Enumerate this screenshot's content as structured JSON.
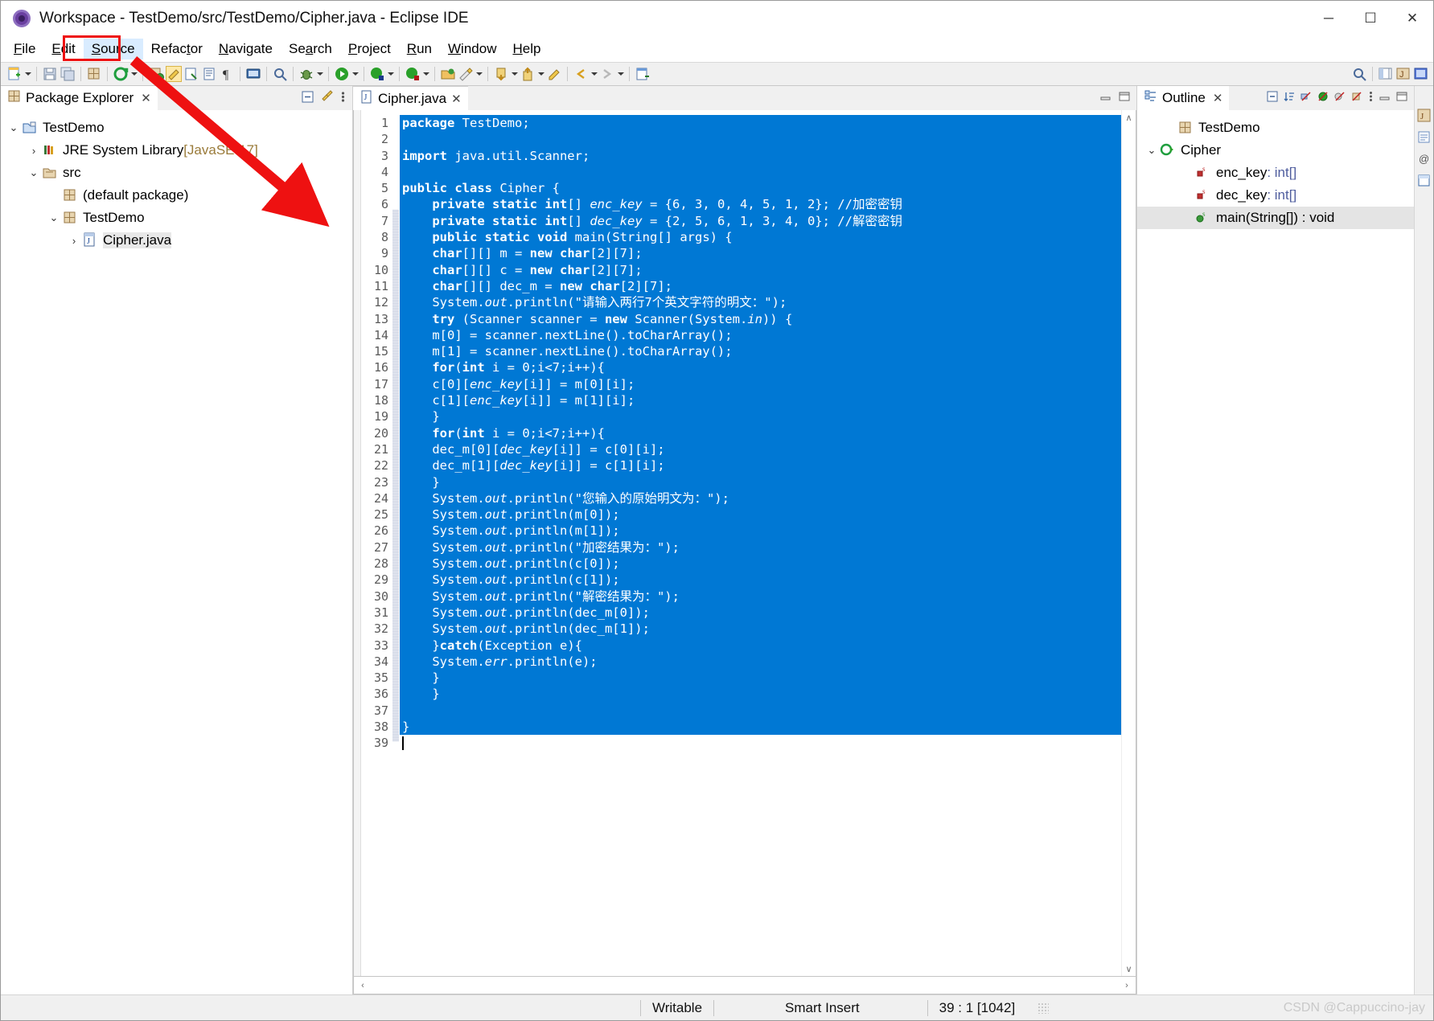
{
  "window": {
    "title": "Workspace - TestDemo/src/TestDemo/Cipher.java - Eclipse IDE",
    "app_icon": "eclipse-icon",
    "minimize_label": "─",
    "maximize_label": "☐",
    "close_label": "✕"
  },
  "menubar": {
    "items": [
      {
        "label": "File",
        "mnemonic": "F",
        "active": false
      },
      {
        "label": "Edit",
        "mnemonic": "E",
        "active": false
      },
      {
        "label": "Source",
        "mnemonic": "S",
        "active": true
      },
      {
        "label": "Refactor",
        "mnemonic": "t",
        "active": false
      },
      {
        "label": "Navigate",
        "mnemonic": "N",
        "active": false
      },
      {
        "label": "Search",
        "mnemonic": "a",
        "active": false
      },
      {
        "label": "Project",
        "mnemonic": "P",
        "active": false
      },
      {
        "label": "Run",
        "mnemonic": "R",
        "active": false
      },
      {
        "label": "Window",
        "mnemonic": "W",
        "active": false
      },
      {
        "label": "Help",
        "mnemonic": "H",
        "active": false
      }
    ],
    "highlight_target": "Source"
  },
  "toolbar": {
    "icons": [
      "new-wizard-icon",
      "save-icon",
      "save-all-icon",
      "new-java-package-icon",
      "run-last-tool-icon",
      "open-type-icon",
      "toggle-mark-occurrences-icon",
      "link-with-editor-icon",
      "show-whitespace-icon",
      "pilcrow-icon",
      "open-console-icon",
      "search-icon",
      "debug-icon",
      "run-icon",
      "coverage-icon",
      "profile-icon",
      "open-perspective-icon",
      "quick-access-icon",
      "previous-annotation-icon",
      "next-annotation-icon",
      "last-edit-location-icon",
      "back-icon",
      "forward-icon",
      "new-editor-icon"
    ],
    "right_icons": [
      "search-icon",
      "open-perspective-icon",
      "java-perspective-icon",
      "java-ee-perspective-icon"
    ]
  },
  "package_explorer": {
    "tab_label": "Package Explorer",
    "tab_close": "✕",
    "view_tools": [
      "collapse-all-icon",
      "link-with-editor-icon",
      "view-menu-icon"
    ],
    "tree": [
      {
        "label": "TestDemo",
        "dim": "",
        "depth": 0,
        "twisty": "⌄",
        "icon": "java-project-icon",
        "selected": false
      },
      {
        "label": "JRE System Library ",
        "dim": "[JavaSE-17]",
        "depth": 1,
        "twisty": "›",
        "icon": "library-icon",
        "selected": false
      },
      {
        "label": "src",
        "dim": "",
        "depth": 1,
        "twisty": "⌄",
        "icon": "source-folder-icon",
        "selected": false
      },
      {
        "label": "(default package)",
        "dim": "",
        "depth": 2,
        "twisty": "",
        "icon": "package-icon",
        "selected": false
      },
      {
        "label": "TestDemo",
        "dim": "",
        "depth": 2,
        "twisty": "⌄",
        "icon": "package-icon",
        "selected": false
      },
      {
        "label": "Cipher.java",
        "dim": "",
        "depth": 3,
        "twisty": "›",
        "icon": "java-file-icon",
        "selected": true
      }
    ]
  },
  "editor": {
    "tab_label": "Cipher.java",
    "tab_icon": "java-file-icon",
    "tab_close": "✕",
    "minimize_label": "─",
    "maximize_label": "☐",
    "total_lines": 39,
    "selection_from_line": 1,
    "selection_to_line": 38,
    "fold_lines": [
      8
    ],
    "lines": [
      {
        "n": 1,
        "text": "package TestDemo;"
      },
      {
        "n": 2,
        "text": ""
      },
      {
        "n": 3,
        "text": "import java.util.Scanner;"
      },
      {
        "n": 4,
        "text": ""
      },
      {
        "n": 5,
        "text": "public class Cipher {"
      },
      {
        "n": 6,
        "text": "    private static int[] enc_key = {6, 3, 0, 4, 5, 1, 2}; //加密密钥"
      },
      {
        "n": 7,
        "text": "    private static int[] dec_key = {2, 5, 6, 1, 3, 4, 0}; //解密密钥"
      },
      {
        "n": 8,
        "text": "    public static void main(String[] args) {"
      },
      {
        "n": 9,
        "text": "    char[][] m = new char[2][7];"
      },
      {
        "n": 10,
        "text": "    char[][] c = new char[2][7];"
      },
      {
        "n": 11,
        "text": "    char[][] dec_m = new char[2][7];"
      },
      {
        "n": 12,
        "text": "    System.out.println(\"请输入两行7个英文字符的明文：\");"
      },
      {
        "n": 13,
        "text": "    try (Scanner scanner = new Scanner(System.in)) {"
      },
      {
        "n": 14,
        "text": "    m[0] = scanner.nextLine().toCharArray();"
      },
      {
        "n": 15,
        "text": "    m[1] = scanner.nextLine().toCharArray();"
      },
      {
        "n": 16,
        "text": "    for(int i = 0;i<7;i++){"
      },
      {
        "n": 17,
        "text": "    c[0][enc_key[i]] = m[0][i];"
      },
      {
        "n": 18,
        "text": "    c[1][enc_key[i]] = m[1][i];"
      },
      {
        "n": 19,
        "text": "    }"
      },
      {
        "n": 20,
        "text": "    for(int i = 0;i<7;i++){"
      },
      {
        "n": 21,
        "text": "    dec_m[0][dec_key[i]] = c[0][i];"
      },
      {
        "n": 22,
        "text": "    dec_m[1][dec_key[i]] = c[1][i];"
      },
      {
        "n": 23,
        "text": "    }"
      },
      {
        "n": 24,
        "text": "    System.out.println(\"您输入的原始明文为：\");"
      },
      {
        "n": 25,
        "text": "    System.out.println(m[0]);"
      },
      {
        "n": 26,
        "text": "    System.out.println(m[1]);"
      },
      {
        "n": 27,
        "text": "    System.out.println(\"加密结果为：\");"
      },
      {
        "n": 28,
        "text": "    System.out.println(c[0]);"
      },
      {
        "n": 29,
        "text": "    System.out.println(c[1]);"
      },
      {
        "n": 30,
        "text": "    System.out.println(\"解密结果为：\");"
      },
      {
        "n": 31,
        "text": "    System.out.println(dec_m[0]);"
      },
      {
        "n": 32,
        "text": "    System.out.println(dec_m[1]);"
      },
      {
        "n": 33,
        "text": "    }catch(Exception e){"
      },
      {
        "n": 34,
        "text": "    System.err.println(e);"
      },
      {
        "n": 35,
        "text": "    }"
      },
      {
        "n": 36,
        "text": "    }"
      },
      {
        "n": 37,
        "text": ""
      },
      {
        "n": 38,
        "text": "}"
      },
      {
        "n": 39,
        "text": ""
      }
    ],
    "scroll_up": "∧",
    "scroll_down": "∨",
    "scroll_left": "‹",
    "scroll_right": "›"
  },
  "outline": {
    "tab_label": "Outline",
    "tab_close": "✕",
    "view_tools": [
      "collapse-all-icon",
      "sort-icon",
      "hide-fields-icon",
      "hide-static-icon",
      "hide-non-public-icon",
      "hide-local-types-icon",
      "view-menu-icon",
      "minimize-icon",
      "maximize-icon"
    ],
    "minimize_label": "─",
    "maximize_label": "☐",
    "items": [
      {
        "label": "TestDemo",
        "type": "",
        "depth": 1,
        "twisty": "",
        "icon": "package-icon",
        "selected": false
      },
      {
        "label": "Cipher",
        "type": "",
        "depth": 0,
        "twisty": "⌄",
        "icon": "class-icon",
        "selected": false
      },
      {
        "label": "enc_key",
        "type": " : int[]",
        "depth": 2,
        "twisty": "",
        "icon": "private-static-field-icon",
        "selected": false
      },
      {
        "label": "dec_key",
        "type": " : int[]",
        "depth": 2,
        "twisty": "",
        "icon": "private-static-field-icon",
        "selected": false
      },
      {
        "label": "main(String[]) : void",
        "type": "",
        "depth": 2,
        "twisty": "",
        "icon": "public-static-method-icon",
        "selected": true
      }
    ]
  },
  "statusbar": {
    "writable": "Writable",
    "insert_mode": "Smart Insert",
    "position": "39 : 1 [1042]",
    "watermark": "CSDN @Cappuccino-jay"
  },
  "colors": {
    "selection_blue": "#0078d4",
    "menu_highlight_red": "#ee1111",
    "annotation_arrow_red": "#ee1111",
    "menu_active_bg": "#d9ecff"
  }
}
